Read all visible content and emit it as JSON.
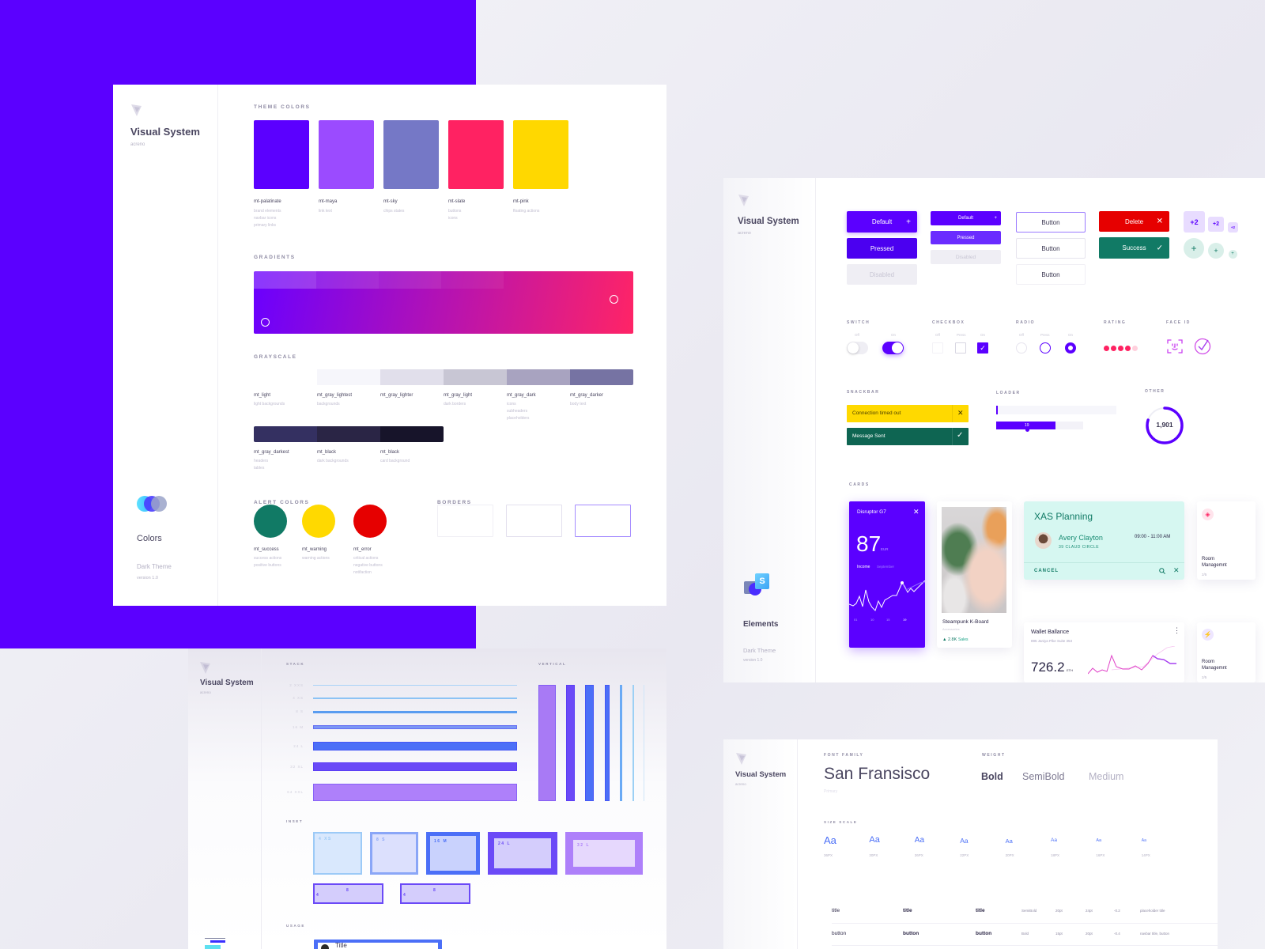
{
  "colors_panel": {
    "brand": "Visual System",
    "sub": "acreno",
    "section_title": "Colors",
    "theme": "Dark Theme",
    "version": "version 1.0",
    "theme_label": "THEME COLORS",
    "theme_colors": [
      {
        "name": "mt-palatinate",
        "color": "#5b00ff",
        "desc": [
          "brand elements",
          "navbar icons",
          "primary links"
        ]
      },
      {
        "name": "mt-maya",
        "color": "#9b4bff",
        "desc": [
          "link text"
        ]
      },
      {
        "name": "mt-sky",
        "color": "#7578c6",
        "desc": [
          "chips states"
        ]
      },
      {
        "name": "mt-slate",
        "color": "#ff2262",
        "desc": [
          "buttons",
          "icons"
        ]
      },
      {
        "name": "mt-pink",
        "color": "#ffd800",
        "desc": [
          "floating actions"
        ]
      }
    ],
    "gradients_label": "GRADIENTS",
    "gradient": {
      "from": "#6a00ff",
      "to": "#ff2466"
    },
    "grayscale_label": "GRAYSCALE",
    "grayscale": [
      {
        "name": "mt_light",
        "color": "#ffffff",
        "desc": [
          "light backgrounds"
        ]
      },
      {
        "name": "mt_gray_lightest",
        "color": "#f6f6fb",
        "desc": [
          "backgrounds"
        ]
      },
      {
        "name": "mt_gray_lighter",
        "color": "#e1dfeb",
        "desc": []
      },
      {
        "name": "mt_gray_light",
        "color": "#c8c6d4",
        "desc": [
          "dark borders"
        ]
      },
      {
        "name": "mt_gray_dark",
        "color": "#a8a3c0",
        "desc": [
          "icons",
          "subheaders",
          "placeholders"
        ]
      },
      {
        "name": "mt_gray_darker",
        "color": "#7673a3",
        "desc": [
          "body text"
        ]
      }
    ],
    "grayscale_dark": [
      {
        "name": "mt_gray_darkest",
        "color": "#343061",
        "desc": [
          "headers",
          "tables"
        ]
      },
      {
        "name": "mt_black",
        "color": "#2a2545",
        "desc": [
          "dark backgrounds"
        ]
      },
      {
        "name": "mt_black",
        "color": "#17142a",
        "desc": [
          "card background"
        ]
      }
    ],
    "alert_label": "ALERT COLORS",
    "alerts": [
      {
        "name": "mt_success",
        "color": "#117a65",
        "desc": [
          "success actions",
          "positive buttons"
        ]
      },
      {
        "name": "mt_warning",
        "color": "#ffd900",
        "desc": [
          "warning actions"
        ]
      },
      {
        "name": "mt_error",
        "color": "#e60000",
        "desc": [
          "critical actions",
          "negative buttons",
          "notifaction"
        ]
      }
    ],
    "borders_label": "BORDERS",
    "borders": [
      "#f0eff5",
      "#e3e0ee",
      "#a58cff"
    ]
  },
  "elements_panel": {
    "brand": "Visual System",
    "sub": "acreno",
    "section_title": "Elements",
    "theme": "Dark Theme",
    "version": "version 1.0",
    "primary_buttons": [
      "Default",
      "Pressed",
      "Disabled"
    ],
    "small_buttons": [
      "Default",
      "Pressed",
      "Disabled"
    ],
    "outline_buttons": [
      "Button",
      "Button",
      "Button"
    ],
    "delete_label": "Delete",
    "success_label": "Success",
    "chips": [
      "+2",
      "+2",
      "+2"
    ],
    "switch_label": "SWITCH",
    "switch_states": [
      "Off",
      "On"
    ],
    "checkbox_label": "CHECKBOX",
    "checkbox_states": [
      "Off",
      "Press",
      "On"
    ],
    "radio_label": "RADIO",
    "radio_states": [
      "Off",
      "Press",
      "On"
    ],
    "rating_label": "RATING",
    "rating": {
      "value": 4,
      "max": 5
    },
    "faceid_label": "FACE ID",
    "snackbar_label": "SNACKBAR",
    "snack_warning": "Connection timed out",
    "snack_success": "Message Sent",
    "loader_label": "LOADER",
    "loader_value": "19",
    "loader_progress": [
      0.01,
      0.68
    ],
    "other_label": "OTHER",
    "other_value": "1,901",
    "other_progress": 0.8,
    "cards_label": "CARDS",
    "card_income": {
      "title": "Disruptor G7",
      "value": "87",
      "unit": "EUR",
      "tab_active": "Income",
      "tab": "September",
      "axis": [
        "01",
        "10",
        "15",
        "19"
      ]
    },
    "card_product": {
      "title": "Steampunk K-Board",
      "category": "Accessories",
      "stat": "▲ 2.8K",
      "stat_label": "Sales"
    },
    "card_planning": {
      "title": "XAS Planning",
      "name": "Avery Clayton",
      "address": "39 CLAUD CIRCLE",
      "time": "09:00 - 11:00 AM",
      "cancel": "CANCEL"
    },
    "card_wallet": {
      "title": "Wallet Ballance",
      "address": "895 Janiya Pike Suite 353",
      "value": "726.2",
      "unit": "ETH"
    },
    "card_rooms": [
      {
        "title_1": "Room",
        "title_2": "Managemnt",
        "count": "2/5"
      },
      {
        "title_1": "Room",
        "title_2": "Managemnt",
        "count": "2/5"
      }
    ],
    "colors": {
      "primary": "#5b00ff",
      "danger": "#e60000",
      "success": "#117a65",
      "warning": "#ffd900",
      "teal": "#d6f7f1",
      "rating": "#ff2262"
    }
  },
  "spacing_panel": {
    "brand": "Visual System",
    "sub": "acreno",
    "stack_label": "STACK",
    "vertical_label": "VERTICAL",
    "inset_label": "INSET",
    "usage_label": "USAGE",
    "stack": [
      {
        "label": "2  XXS",
        "size": 2,
        "color": "#a9d2f7"
      },
      {
        "label": "4  XS",
        "size": 4,
        "color": "#8cc3f5"
      },
      {
        "label": "8  S",
        "size": 8,
        "color": "#5a9cf0"
      },
      {
        "label": "16  M",
        "size": 16,
        "color": "#7b96f5"
      },
      {
        "label": "24  L",
        "size": 24,
        "color": "#4b6ff7"
      },
      {
        "label": "32  XL",
        "size": 32,
        "color": "#6a4af7"
      },
      {
        "label": "64  XXL",
        "size": 64,
        "color": "#ae80fa"
      }
    ],
    "vertical": [
      {
        "size": 64,
        "color": "#a87af5"
      },
      {
        "size": 32,
        "color": "#6b4af7"
      },
      {
        "size": 24,
        "color": "#4b6ff7"
      },
      {
        "size": 16,
        "color": "#4b6ff7"
      },
      {
        "size": 8,
        "color": "#6aaaf5"
      },
      {
        "size": 4,
        "color": "#9cd0f5"
      },
      {
        "size": 2,
        "color": "#cfe5f8"
      }
    ],
    "inset": [
      {
        "label": "4  XS",
        "border": "#9ccaf7",
        "fill": "#d9e8fd"
      },
      {
        "label": "8  S",
        "border": "#8aa6f7",
        "fill": "#dce0fd"
      },
      {
        "label": "16  M",
        "border": "#4b6ff7",
        "fill": "#c9d2fd"
      },
      {
        "label": "24  L",
        "border": "#6b4af7",
        "fill": "#d4cdfc"
      },
      {
        "label": "32  L",
        "border": "#ae80fa",
        "fill": "#e6d8fd"
      }
    ],
    "inset_small": [
      {
        "a": "4",
        "b": "8"
      },
      {
        "a": "4",
        "b": "8"
      }
    ],
    "usage_title": "Title"
  },
  "type_panel": {
    "brand": "Visual System",
    "sub": "acreno",
    "font_family_label": "FONT FAMILY",
    "font_family": "San Fransisco",
    "font_role": "Primary",
    "weight_label": "WEIGHT",
    "weights": [
      "Bold",
      "SemiBold",
      "Medium"
    ],
    "size_label": "SIZE SCALE",
    "sample": "Aa",
    "sizes": [
      "36PX",
      "30PX",
      "26PX",
      "22PX",
      "20PX",
      "18PX",
      "16PX",
      "14PX"
    ],
    "table": [
      [
        "title",
        "title",
        "title",
        "SemiBold",
        "20pt",
        "24pt",
        "-0.2",
        "placeholder title"
      ],
      [
        "button",
        "button",
        "button",
        "Bold",
        "15pt",
        "20pt",
        "-0.4",
        "navbar title, button"
      ]
    ]
  }
}
